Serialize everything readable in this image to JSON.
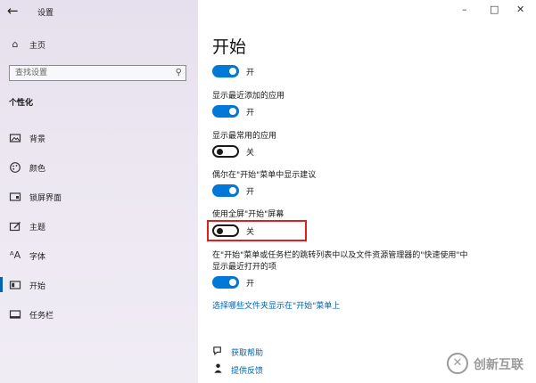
{
  "window": {
    "title": "设置",
    "controls": {
      "minimize": "–",
      "maximize": "□",
      "close": "✕"
    }
  },
  "sidebar": {
    "home": "主页",
    "search_placeholder": "查找设置",
    "section_title": "个性化",
    "items": [
      {
        "label": "背景",
        "icon": "picture-icon"
      },
      {
        "label": "颜色",
        "icon": "palette-icon"
      },
      {
        "label": "锁屏界面",
        "icon": "lock-screen-icon"
      },
      {
        "label": "主题",
        "icon": "theme-icon"
      },
      {
        "label": "字体",
        "icon": "font-icon"
      },
      {
        "label": "开始",
        "icon": "start-icon",
        "active": true
      },
      {
        "label": "任务栏",
        "icon": "taskbar-icon"
      }
    ],
    "accent_color": "#0063b1"
  },
  "main": {
    "title": "开始",
    "settings": [
      {
        "label": "",
        "state": "开",
        "on": true
      },
      {
        "label": "显示最近添加的应用",
        "state": "开",
        "on": true
      },
      {
        "label": "显示最常用的应用",
        "state": "关",
        "on": false
      },
      {
        "label": "偶尔在\"开始\"菜单中显示建议",
        "state": "开",
        "on": true
      },
      {
        "label": "使用全屏\"开始\"屏幕",
        "state": "关",
        "on": false,
        "highlighted": true
      },
      {
        "label_line1": "在\"开始\"菜单或任务栏的跳转列表中以及文件资源管理器的\"快速使用\"中",
        "label_line2": "显示最近打开的项",
        "state": "开",
        "on": true
      }
    ],
    "folders_link": "选择哪些文件夹显示在\"开始\"菜单上",
    "help": {
      "get_help": "获取帮助",
      "feedback": "提供反馈"
    },
    "toggle_on_color": "#0078d7",
    "highlight_color": "#e02020"
  },
  "watermark": {
    "text": "创新互联"
  }
}
